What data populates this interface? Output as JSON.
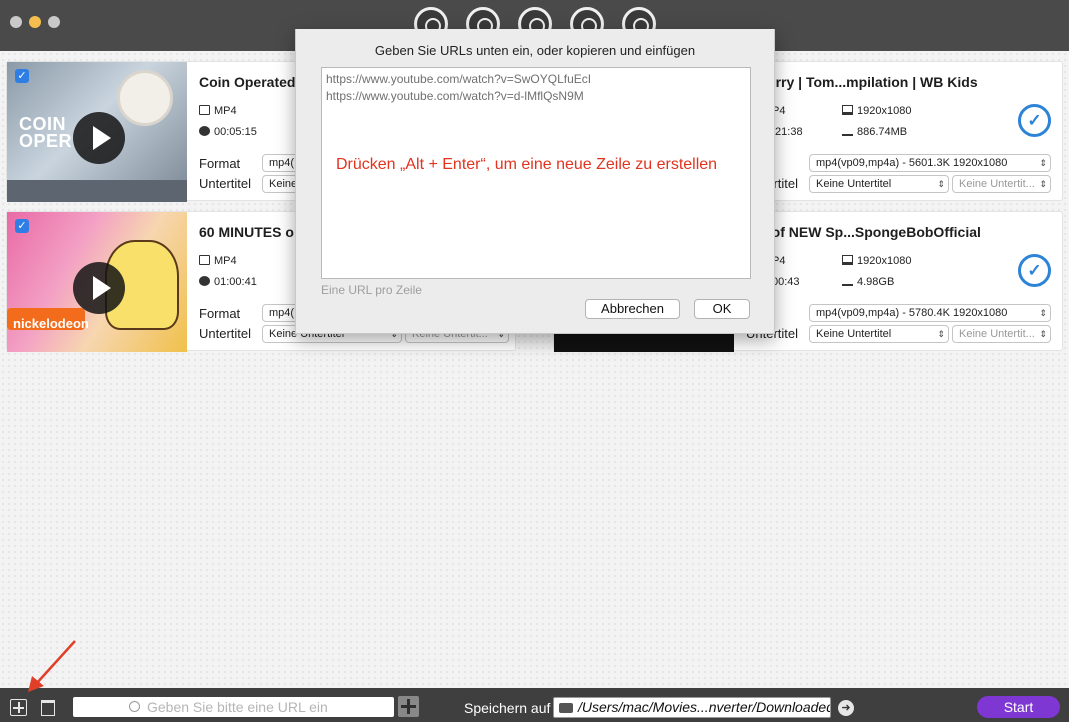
{
  "window": {
    "toolbar_icons": [
      "convert-icon",
      "reload-icon",
      "film-reel-icon",
      "film-reel-add-icon",
      "film-reel-settings-icon"
    ]
  },
  "cards": [
    {
      "title": "Coin Operated",
      "container": "MP4",
      "duration": "00:05:15",
      "format_label": "Format",
      "format_value": "mp4(",
      "subtitle_label": "Untertitel",
      "subtitle_value": "Keine",
      "thumb_caption": "COIN\nOPER"
    },
    {
      "title": "60 MINUTES o",
      "container": "MP4",
      "duration": "01:00:41",
      "format_label": "Format",
      "format_value": "mp4(",
      "subtitle_label": "Untertitel",
      "subtitle_value": "Keine Untertitel",
      "subtitle_value2": "Keine Untertit...",
      "thumb_caption": "nickelodeon"
    },
    {
      "title": "& Jerry | Tom...mpilation | WB Kids",
      "container": "P4",
      "duration": ":21:38",
      "resolution": "1920x1080",
      "size": "886.74MB",
      "format_label": "at",
      "format_value": "mp4(vp09,mp4a) - 5601.3K 1920x1080",
      "subtitle_label": "Untertitel",
      "subtitle_value": "Keine Untertitel",
      "subtitle_value2": "Keine Untertit..."
    },
    {
      "title": "urs of NEW Sp...SpongeBobOfficial",
      "container": "P4",
      "duration": "00:43",
      "resolution": "1920x1080",
      "size": "4.98GB",
      "format_label": "at",
      "format_value": "mp4(vp09,mp4a) - 5780.4K 1920x1080",
      "subtitle_label": "Untertitel",
      "subtitle_value": "Keine Untertitel",
      "subtitle_value2": "Keine Untertit..."
    }
  ],
  "dialog": {
    "title": "Geben Sie URLs unten ein, oder kopieren und einfügen",
    "urls": [
      "https://www.youtube.com/watch?v=SwOYQLfuEcI",
      "https://www.youtube.com/watch?v=d-lMflQsN9M"
    ],
    "hint": "Drücken „Alt + Enter“, um eine neue Zeile zu erstellen",
    "footer_note": "Eine URL pro Zeile",
    "cancel_label": "Abbrechen",
    "ok_label": "OK"
  },
  "bottom": {
    "search_placeholder": "Geben Sie bitte eine URL ein",
    "save_label": "Speichern auf",
    "save_path": "/Users/mac/Movies...nverter/Downloaded",
    "start_label": "Start"
  },
  "colors": {
    "accent_check": "#2d83d6",
    "start_button": "#7e37d2",
    "hint_text": "#e2331f",
    "annotation_arrow": "#e0402a"
  }
}
